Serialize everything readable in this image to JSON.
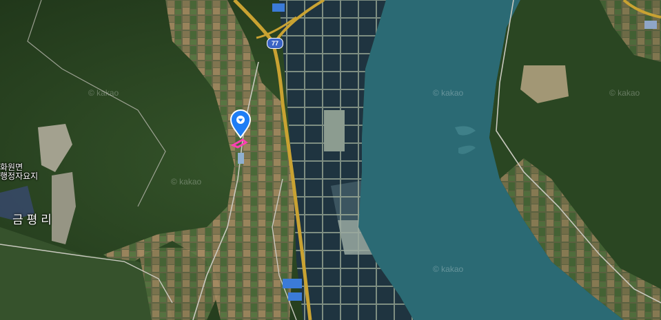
{
  "map": {
    "provider": "kakao",
    "view": "skyview"
  },
  "labels": {
    "place_line1": "화원면",
    "place_line2": "행정자요지",
    "district": "금평리",
    "route_number": "77"
  },
  "watermarks": [
    "© kakao",
    "© kakao",
    "© kakao",
    "© kakao",
    "© kakao"
  ],
  "marker": {
    "icon": "location-pin-icon",
    "color": "#1e7df5",
    "highlight_color": "#ff3fb4"
  },
  "colors": {
    "water": "#2b6a74",
    "forest": "#2f4a26",
    "highway": "#c9a232"
  }
}
